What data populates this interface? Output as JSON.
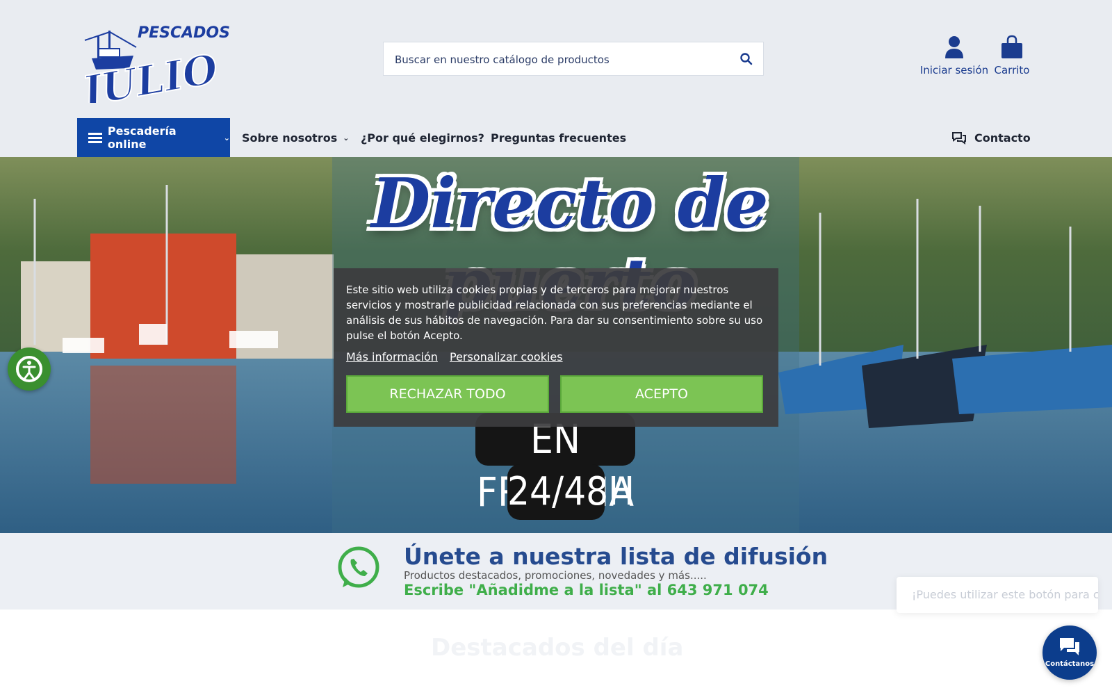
{
  "brand": {
    "name_top": "PESCADOS",
    "name_main": "JULIO"
  },
  "search": {
    "placeholder": "Buscar en nuestro catálogo de productos"
  },
  "header_actions": {
    "login_label": "Iniciar sesión",
    "cart_label": "Carrito"
  },
  "nav": {
    "main_label": "Pescadería online",
    "items": [
      {
        "label": "Sobre nosotros",
        "dropdown": true
      },
      {
        "label": "¿Por qué elegirnos?",
        "dropdown": false
      },
      {
        "label": "Preguntas frecuentes",
        "dropdown": false
      }
    ],
    "contact_label": "Contacto"
  },
  "hero": {
    "title": "Directo de puerto",
    "line3": "EN FRANCIA",
    "line4": "24/48H"
  },
  "cookie": {
    "text": "Este sitio web utiliza cookies propias y de terceros para mejorar nuestros servicios y mostrarle publicidad relacionada con sus preferencias mediante el análisis de sus hábitos de navegación. Para dar su consentimiento sobre su uso pulse el botón Acepto.",
    "more_info": "Más información",
    "customize": "Personalizar cookies",
    "reject": "RECHAZAR TODO",
    "accept": "ACEPTO"
  },
  "whatsapp": {
    "title": "Únete a nuestra lista de difusión",
    "subtitle": "Productos destacados, promociones, novedades y más.....",
    "cta": "Escribe \"Añadidme a la lista\" al 643 971 074"
  },
  "below": {
    "ghost_title": "Destacados del día"
  },
  "chat": {
    "tooltip": "¡Puedes utilizar este botón para conta",
    "button_label": "Contáctanos"
  },
  "colors": {
    "primary": "#0f46a6",
    "green": "#7cc454",
    "whatsapp": "#3fae4a"
  }
}
